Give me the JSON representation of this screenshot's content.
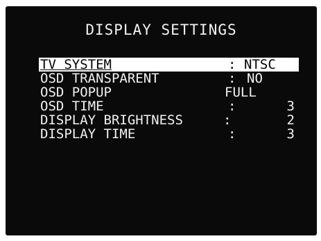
{
  "screen": {
    "title": "DISPLAY SETTINGS"
  },
  "menu": {
    "items": [
      {
        "label": "TV SYSTEM",
        "separator": ":",
        "value": "NTSC"
      },
      {
        "label": "OSD TRANSPARENT",
        "separator": ":",
        "value": "NO"
      },
      {
        "label": "OSD POPUP",
        "separator": "",
        "value": "FULL"
      },
      {
        "label": "OSD TIME",
        "separator": ":",
        "value": "3"
      },
      {
        "label": "DISPLAY BRIGHTNESS",
        "separator": ":",
        "value": "2"
      },
      {
        "label": "DISPLAY TIME",
        "separator": ":",
        "value": "3"
      }
    ]
  },
  "colors": {
    "background": "#0a0a0a",
    "text": "#f2f2f2",
    "highlight_bg": "#ffffff",
    "highlight_text": "#000000"
  }
}
